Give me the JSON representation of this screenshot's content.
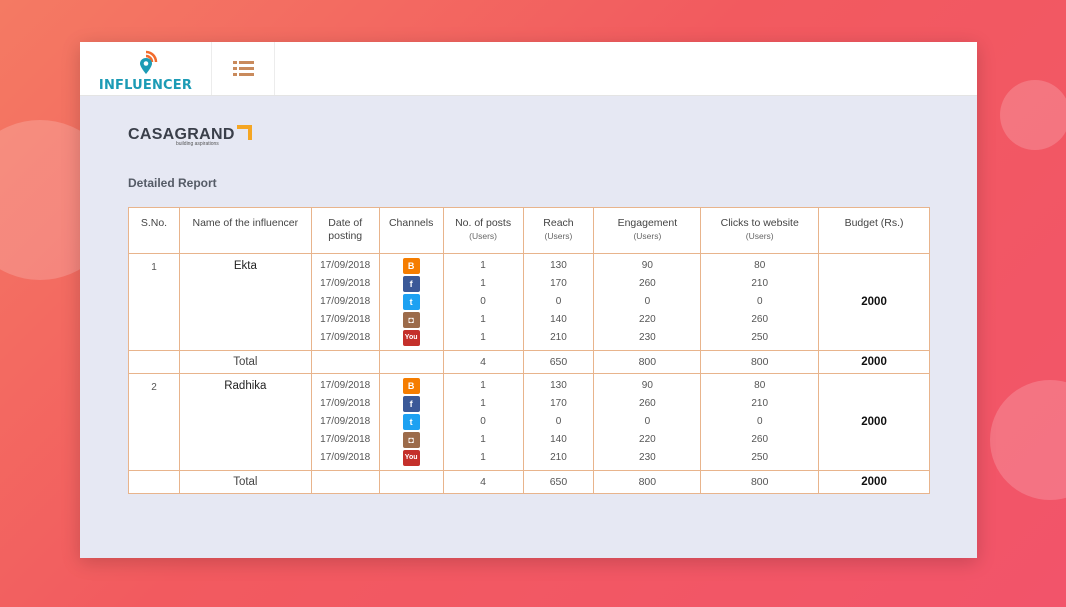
{
  "app": {
    "logo_text": "INFLUENCER"
  },
  "brand": {
    "name": "CASAGRAND",
    "tagline": "building aspirations"
  },
  "report": {
    "title": "Detailed Report"
  },
  "table": {
    "headers": {
      "sno": "S.No.",
      "name": "Name of the influencer",
      "date": "Date of posting",
      "channels": "Channels",
      "posts": "No. of posts",
      "posts_sub": "(Users)",
      "reach": "Reach",
      "reach_sub": "(Users)",
      "engagement": "Engagement",
      "engagement_sub": "(Users)",
      "clicks": "Clicks to website",
      "clicks_sub": "(Users)",
      "budget": "Budget (Rs.)"
    },
    "influencers": [
      {
        "sno": "1",
        "name": "Ekta",
        "dates": [
          "17/09/2018",
          "17/09/2018",
          "17/09/2018",
          "17/09/2018",
          "17/09/2018"
        ],
        "channels": [
          "blogger-icon",
          "facebook-icon",
          "twitter-icon",
          "instagram-icon",
          "youtube-icon"
        ],
        "posts": [
          "1",
          "1",
          "0",
          "1",
          "1"
        ],
        "reach": [
          "130",
          "170",
          "0",
          "140",
          "210"
        ],
        "engagement": [
          "90",
          "260",
          "0",
          "220",
          "230"
        ],
        "clicks": [
          "80",
          "210",
          "0",
          "260",
          "250"
        ],
        "budget": "2000",
        "total": {
          "label": "Total",
          "posts": "4",
          "reach": "650",
          "engagement": "800",
          "clicks": "800",
          "budget": "2000"
        }
      },
      {
        "sno": "2",
        "name": "Radhika",
        "dates": [
          "17/09/2018",
          "17/09/2018",
          "17/09/2018",
          "17/09/2018",
          "17/09/2018"
        ],
        "channels": [
          "blogger-icon",
          "facebook-icon",
          "twitter-icon",
          "instagram-icon",
          "youtube-icon"
        ],
        "posts": [
          "1",
          "1",
          "0",
          "1",
          "1"
        ],
        "reach": [
          "130",
          "170",
          "0",
          "140",
          "210"
        ],
        "engagement": [
          "90",
          "260",
          "0",
          "220",
          "230"
        ],
        "clicks": [
          "80",
          "210",
          "0",
          "260",
          "250"
        ],
        "budget": "2000",
        "total": {
          "label": "Total",
          "posts": "4",
          "reach": "650",
          "engagement": "800",
          "clicks": "800",
          "budget": "2000"
        }
      }
    ]
  },
  "colors": {
    "accent": "#1c9bb5",
    "logo_orange": "#f26b2c",
    "table_border": "#e8b48c",
    "menu_icon": "#c98a5c",
    "brand_mark": "#f5a623"
  }
}
